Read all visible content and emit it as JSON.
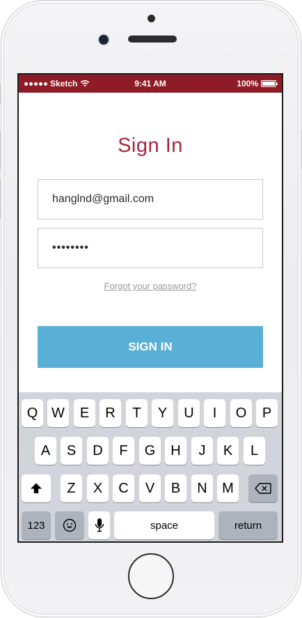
{
  "status_bar": {
    "carrier": "Sketch",
    "time": "9:41 AM",
    "battery": "100%"
  },
  "page": {
    "title": "Sign In",
    "email_value": "hanglnd@gmail.com",
    "password_value": "••••••••",
    "forgot_link": "Forgot your password?",
    "signin_button": "SIGN IN"
  },
  "keyboard": {
    "row1": [
      "Q",
      "W",
      "E",
      "R",
      "T",
      "Y",
      "U",
      "I",
      "O",
      "P"
    ],
    "row2": [
      "A",
      "S",
      "D",
      "F",
      "G",
      "H",
      "J",
      "K",
      "L"
    ],
    "row3": [
      "Z",
      "X",
      "C",
      "V",
      "B",
      "N",
      "M"
    ],
    "numbers_key": "123",
    "space_key": "space",
    "return_key": "return",
    "shift_icon": "shift-icon",
    "delete_icon": "delete-icon",
    "emoji_icon": "emoji-icon",
    "mic_icon": "microphone-icon"
  },
  "colors": {
    "status_bar": "#8e1b26",
    "title": "#a5273a",
    "button": "#59afd6",
    "keyboard_bg": "#d1d5db"
  }
}
